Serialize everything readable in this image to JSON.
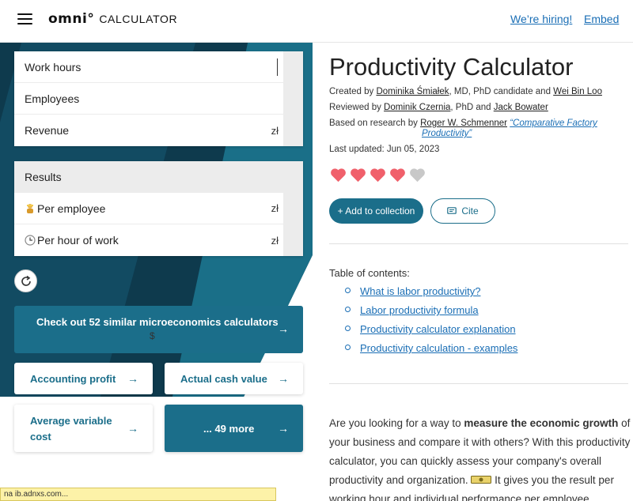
{
  "header": {
    "logo_mark": "omni°",
    "logo_word": "CALCULATOR",
    "hiring_link": "We’re hiring!",
    "embed_link": "Embed"
  },
  "calculator": {
    "inputs": [
      {
        "label": "Work hours",
        "unit": ""
      },
      {
        "label": "Employees",
        "unit": ""
      },
      {
        "label": "Revenue",
        "unit": "zł"
      }
    ],
    "results_label": "Results",
    "results": [
      {
        "label": "Per employee",
        "unit": "zł",
        "icon": "worker-emoji-icon"
      },
      {
        "label": "Per hour of work",
        "unit": "zł",
        "icon": "clock-emoji-icon"
      }
    ]
  },
  "promo": {
    "big_button": "Check out 52 similar microeconomics calculators",
    "big_button_icon": "$",
    "tiles": [
      "Accounting profit",
      "Actual cash value",
      "Average variable cost"
    ],
    "more": "... 49 more"
  },
  "status_bar": "na ib.adnxs.com...",
  "article": {
    "title": "Productivity Calculator",
    "created_by_prefix": "Created by ",
    "author1": "Dominika Śmiałek",
    "author1_suffix": ", MD, PhD candidate and ",
    "author2": "Wei Bin Loo",
    "reviewed_prefix": "Reviewed by ",
    "reviewer1": "Dominik Czernia",
    "reviewer1_suffix": ", PhD and ",
    "reviewer2": "Jack Bowater",
    "based_prefix": "Based on research by ",
    "researcher": "Roger W. Schmenner",
    "reference_line1": "“Comparative Factory",
    "reference_line2": "Productivity”",
    "last_updated": "Last updated: Jun 05, 2023",
    "rating": {
      "filled": 4,
      "total": 5,
      "filled_color": "#f0606b",
      "empty_color": "#c8c8c8"
    },
    "add_button": "+ Add to collection",
    "cite_button": "Cite",
    "toc_title": "Table of contents:",
    "toc": [
      "What is labor productivity?",
      "Labor productivity formula",
      "Productivity calculator explanation",
      "Productivity calculation - examples"
    ],
    "intro_1": "Are you looking for a way to ",
    "intro_bold": "measure the economic growth",
    "intro_2": " of your business and compare it with others? With this productivity calculator, you can quickly assess your company's overall productivity and organization. ",
    "intro_3": " It gives you the result per working hour and individual performance per employee."
  },
  "colors": {
    "accent": "#1b6e8a",
    "link": "#1a6eb5",
    "dark_bg": "#0e3a4d"
  }
}
